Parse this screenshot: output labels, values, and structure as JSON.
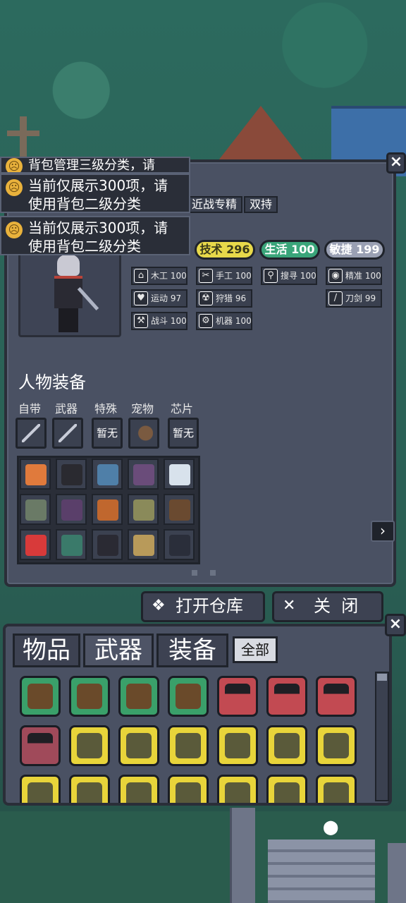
{
  "notifications": [
    {
      "text": "当前仅展示300项，请 使用背包二级分类"
    },
    {
      "text": "当前仅展示300项，请 使用背包二级分类"
    }
  ],
  "notification_partial": "背包管理三级分类，请",
  "character": {
    "tags": [
      "近战专精",
      "双持"
    ],
    "stats": [
      {
        "label": "技术 296",
        "color": "#e8d94a"
      },
      {
        "label": "生活 100",
        "color": "#3aa57a"
      },
      {
        "label": "敏捷 199",
        "color": "#9aa0b3"
      }
    ],
    "skills": [
      {
        "icon": "house-icon",
        "glyph": "⌂",
        "label": "木工 100"
      },
      {
        "icon": "scissors-icon",
        "glyph": "✂",
        "label": "手工 100"
      },
      {
        "icon": "magnifier-icon",
        "glyph": "⚲",
        "label": "搜寻 100"
      },
      {
        "icon": "eye-icon",
        "glyph": "◉",
        "label": "精准 100"
      },
      {
        "icon": "heart-icon",
        "glyph": "♥",
        "label": "运动 97"
      },
      {
        "icon": "radiation-icon",
        "glyph": "☢",
        "label": "狩猎 96"
      },
      {
        "icon": "blade-icon",
        "glyph": "/",
        "label": "刀剑 99"
      },
      {
        "icon": "wrench-icon",
        "glyph": "⚒",
        "label": "战斗 100"
      },
      {
        "icon": "gear-icon",
        "glyph": "⚙",
        "label": "机器 100"
      }
    ]
  },
  "equipment": {
    "title": "人物装备",
    "slots": [
      {
        "label": "自带",
        "content": "",
        "icon": "spear-icon"
      },
      {
        "label": "武器",
        "content": "",
        "icon": "blade-icon"
      },
      {
        "label": "特殊",
        "content": "暂无",
        "icon": ""
      },
      {
        "label": "宠物",
        "content": "",
        "icon": "pet-icon"
      },
      {
        "label": "芯片",
        "content": "暂无",
        "icon": ""
      }
    ],
    "items": [
      {
        "icon": "ring-icon",
        "color": "#e07a3c"
      },
      {
        "icon": "microphone-icon",
        "color": "#2a2a30"
      },
      {
        "icon": "shirt-icon",
        "color": "#4f7fa8"
      },
      {
        "icon": "vest-icon",
        "color": "#6a4c7a"
      },
      {
        "icon": "cloth-icon",
        "color": "#d8e2ec"
      },
      {
        "icon": "cap-icon",
        "color": "#6a7a66"
      },
      {
        "icon": "shoes-icon",
        "color": "#5a3f6a"
      },
      {
        "icon": "bag-icon",
        "color": "#c0672e"
      },
      {
        "icon": "jacket-icon",
        "color": "#8a8a5a"
      },
      {
        "icon": "backpack-icon",
        "color": "#6a4a30"
      },
      {
        "icon": "medkit-icon",
        "color": "#d83a3a"
      },
      {
        "icon": "canteen-icon",
        "color": "#3a7a6a"
      },
      {
        "icon": "sneaker-icon",
        "color": "#2a2a33"
      },
      {
        "icon": "boots-icon",
        "color": "#b89a5a"
      },
      {
        "icon": "pants-icon",
        "color": "#2a2e3a"
      }
    ]
  },
  "actions": {
    "open_storage": "打开仓库",
    "close": "关  闭"
  },
  "bag": {
    "tabs": [
      "物品",
      "武器",
      "装备"
    ],
    "filter": "全部",
    "rows": [
      [
        {
          "icon": "otter-icon",
          "bg": "#3aa06a"
        },
        {
          "icon": "squirrel-icon",
          "bg": "#3aa06a"
        },
        {
          "icon": "snail-icon",
          "bg": "#3aa06a"
        },
        {
          "icon": "mouse-icon",
          "bg": "#3aa06a"
        },
        {
          "icon": "gun-icon",
          "bg": "#c24a52"
        },
        {
          "icon": "gun-icon",
          "bg": "#c24a52"
        },
        {
          "icon": "gun-icon",
          "bg": "#c24a52"
        }
      ],
      [
        {
          "icon": "gun-icon",
          "bg": "#a04a5a"
        },
        {
          "icon": "sack-icon",
          "bg": "#e8d43a"
        },
        {
          "icon": "sack-icon",
          "bg": "#e8d43a"
        },
        {
          "icon": "sack-icon",
          "bg": "#e8d43a"
        },
        {
          "icon": "sack-icon",
          "bg": "#e8d43a"
        },
        {
          "icon": "sack-icon",
          "bg": "#e8d43a"
        },
        {
          "icon": "sack-icon",
          "bg": "#e8d43a"
        }
      ],
      [
        {
          "icon": "sack-icon",
          "bg": "#e8d43a"
        },
        {
          "icon": "sack-icon",
          "bg": "#e8d43a"
        },
        {
          "icon": "sack-icon",
          "bg": "#e8d43a"
        },
        {
          "icon": "sack-icon",
          "bg": "#e8d43a"
        },
        {
          "icon": "sack-icon",
          "bg": "#e8d43a"
        },
        {
          "icon": "sack-icon",
          "bg": "#e8d43a"
        },
        {
          "icon": "sack-icon",
          "bg": "#e8d43a"
        }
      ]
    ]
  }
}
